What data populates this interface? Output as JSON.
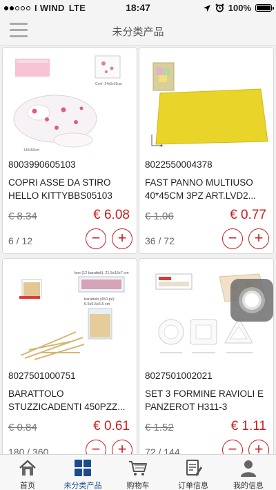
{
  "status_bar": {
    "carrier": "I WIND",
    "network": "LTE",
    "time": "18:47",
    "battery": "100%"
  },
  "header": {
    "title": "未分类产品"
  },
  "products": [
    {
      "code": "8003990605103",
      "name_line1": "COPRI ASSE DA STIRO",
      "name_line2": "HELLO KITTYBBS05103",
      "old_price": "€ 8.34",
      "new_price": "€ 6.08",
      "stock": "6 / 12",
      "img_text_1": "Conf. 24x6x36cm",
      "img_text_2": "140x50cm"
    },
    {
      "code": "8022550004378",
      "name_line1": "FAST PANNO MULTIUSO",
      "name_line2": "40*45CM 3PZ ART.LVD2...",
      "old_price": "€ 1.06",
      "new_price": "€ 0.77",
      "stock": "36 / 72"
    },
    {
      "code": "8027501000751",
      "name_line1": "BARATTOLO",
      "name_line2": "STUZZICADENTI 450PZZ...",
      "old_price": "€ 0.84",
      "new_price": "€ 0.61",
      "stock": "180 / 360",
      "img_text_1": "box (12 barattoli): 21.5x16x7 cm",
      "img_text_2": "barattolo (450 pz):",
      "img_text_3": "5.5x5.5x6.5 cm"
    },
    {
      "code": "8027501002021",
      "name_line1": "SET 3 FORMINE RAVIOLI E",
      "name_line2": "PANZEROT H311-3",
      "old_price": "€ 1.52",
      "new_price": "€ 1.11",
      "stock": "72 / 144"
    }
  ],
  "tabs": [
    {
      "label": "首页",
      "icon": "home-icon"
    },
    {
      "label": "未分类产品",
      "icon": "grid-icon",
      "active": true
    },
    {
      "label": "购物车",
      "icon": "cart-icon"
    },
    {
      "label": "订单信息",
      "icon": "order-icon"
    },
    {
      "label": "我的信息",
      "icon": "user-icon"
    }
  ],
  "colors": {
    "accent_red": "#c81c1c",
    "tab_active": "#1d4b8a",
    "panno_yellow": "#e9d42a"
  }
}
